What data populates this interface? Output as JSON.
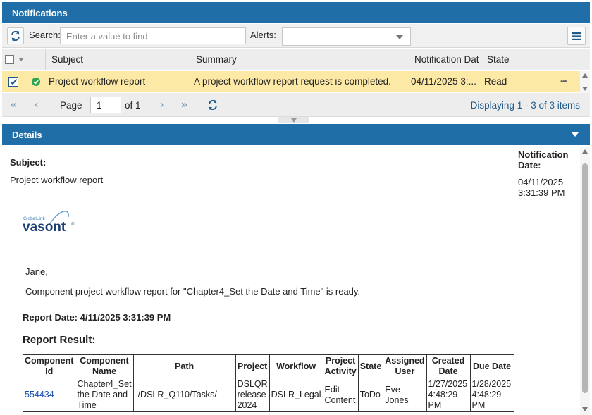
{
  "notifications": {
    "title": "Notifications"
  },
  "toolbar": {
    "search_label": "Search:",
    "search_placeholder": "Enter a value to find",
    "alerts_label": "Alerts:",
    "alerts_value": ""
  },
  "grid": {
    "columns": [
      "Subject",
      "Summary",
      "Notification Dat",
      "State"
    ],
    "row": {
      "subject": "Project workflow report",
      "summary": "A project workflow report request is completed.",
      "date": "04/11/2025 3:...",
      "state": "Read",
      "more": "•••"
    }
  },
  "pager": {
    "page_label": "Page",
    "page_value": "1",
    "of_label": "of 1",
    "displaying": "Displaying 1 - 3 of 3 items"
  },
  "details": {
    "title": "Details",
    "subject_label": "Subject:",
    "subject_value": "Project workflow report",
    "date_label_1": "Notification",
    "date_label_2": "Date:",
    "date_value_1": "04/11/2025",
    "date_value_2": "3:31:39 PM",
    "logo_small": "GlobalLink",
    "logo_main": "vasont",
    "greeting": "Jane,",
    "message": "Component project workflow report for \"Chapter4_Set the Date and Time\" is ready.",
    "report_date": "Report Date: 4/11/2025 3:31:39 PM",
    "report_result": "Report Result:",
    "table_headers": [
      "Component Id",
      "Component Name",
      "Path",
      "Project",
      "Workflow",
      "Project Activity",
      "State",
      "Assigned User",
      "Created Date",
      "Due Date"
    ],
    "table_row": {
      "id": "554434",
      "name": "Chapter4_Set the Date and Time",
      "path": "/DSLR_Q110/Tasks/",
      "project": "DSLQR release 2024",
      "workflow": "DSLR_Legal",
      "activity": "Edit Content",
      "state": "ToDo",
      "user": "Eve Jones",
      "created": "1/27/2025 4:48:29 PM",
      "due": "1/28/2025 4:48:29 PM"
    }
  },
  "colors": {
    "header_blue": "#1f6ea8",
    "row_highlight": "#fde9a6",
    "ok_green": "#2ea44f",
    "link_blue": "#1a4fb4"
  }
}
